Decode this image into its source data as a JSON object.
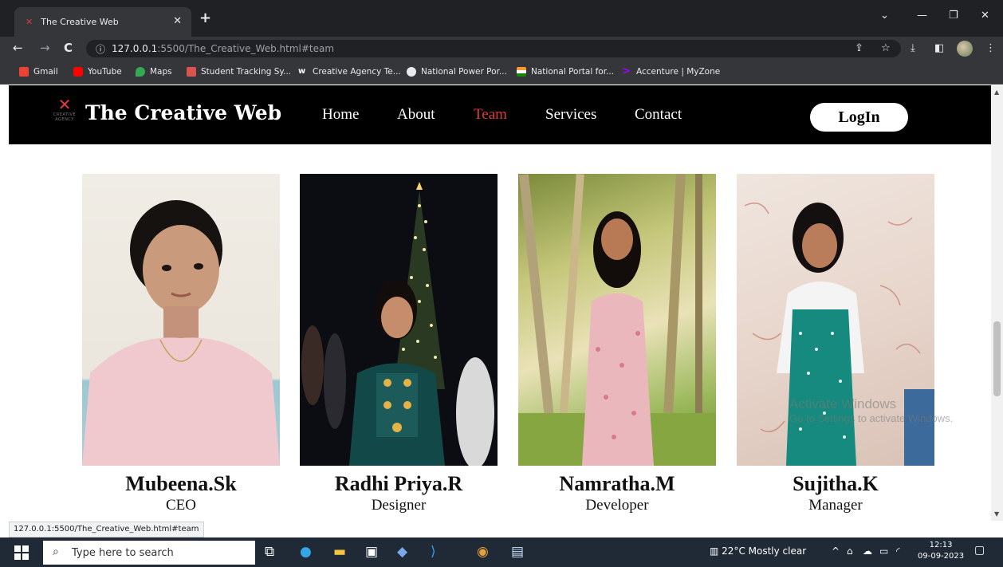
{
  "browser": {
    "tab_title": "The Creative Web",
    "url_host": "127.0.0.1",
    "url_path": ":5500/The_Creative_Web.html#team",
    "status_url": "127.0.0.1:5500/The_Creative_Web.html#team"
  },
  "bookmarks": [
    {
      "label": "Gmail",
      "color": "#ea4335"
    },
    {
      "label": "YouTube",
      "color": "#ff0000"
    },
    {
      "label": "Maps",
      "color": "#34a853"
    },
    {
      "label": "Student Tracking Sy...",
      "color": "#d9534f"
    },
    {
      "label": "Creative Agency Te...",
      "color": "#ffffff"
    },
    {
      "label": "National Power Por...",
      "color": "#e8eaed"
    },
    {
      "label": "National Portal for...",
      "color": "#ff9933"
    },
    {
      "label": "Accenture | MyZone",
      "color": "#a100ff"
    }
  ],
  "site": {
    "brand": "The Creative Web",
    "logo_sub": "CREATIVE AGENCY",
    "nav": [
      "Home",
      "About",
      "Team",
      "Services",
      "Contact"
    ],
    "active_nav": "Team",
    "login_label": "LogIn",
    "accent_color": "#e03a3e"
  },
  "team": [
    {
      "name": "Mubeena.Sk",
      "role": "CEO"
    },
    {
      "name": "Radhi Priya.R",
      "role": "Designer"
    },
    {
      "name": "Namratha.M",
      "role": "Developer"
    },
    {
      "name": "Sujitha.K",
      "role": "Manager"
    }
  ],
  "watermark": {
    "line1": "Activate Windows",
    "line2": "Go to Settings to activate Windows."
  },
  "taskbar": {
    "search_placeholder": "Type here to search",
    "weather": "22°C  Mostly clear",
    "time": "12:13",
    "date": "09-09-2023"
  }
}
